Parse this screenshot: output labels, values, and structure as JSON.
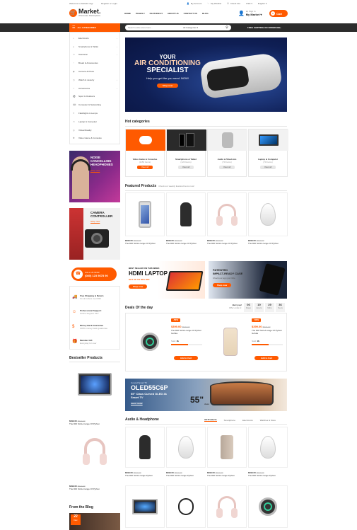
{
  "topbar": {
    "welcome": "Welcome to Default msg!",
    "register": "Register or Login",
    "account": "My Account",
    "wishlist": "My Wishlist",
    "checkout": "Check Out",
    "currency": "USD",
    "language": "English"
  },
  "brand": {
    "name": "Market.",
    "tagline": "Wholesale Marketplace"
  },
  "nav": [
    "HOME",
    "PAGES",
    "FEATURES",
    "ABOUT US",
    "CONTACT US",
    "BLOG"
  ],
  "user": {
    "signin": "Hi, Sign in",
    "account": "My Market"
  },
  "cart": {
    "count": "0",
    "label": "Cart"
  },
  "catbar": {
    "all": "ALL CATEGORIES",
    "search_placeholder": "Search entire store here...",
    "category_select": "All Categories",
    "free_shipping": "FREE SHIPPING ON ORDER $99+"
  },
  "sidebar_categories": [
    "Electronics",
    "Smartphone & Tablet",
    "Television",
    "Bread & Accessories",
    "Camera & Photo",
    "Watch & Jewelry",
    "Accessories",
    "Sport & Outdoors",
    "Computer & Networking",
    "Flashlights & Lamps",
    "Laptop & Computer",
    "Virtual Reality",
    "Video Game & Consoles"
  ],
  "hero": {
    "line1": "YOUR",
    "line2": "AIR CONDITIONING",
    "line3": "SPECIALIST",
    "sub": "Help you get the you need. NOW!",
    "btn": "Shop now"
  },
  "side_banner1": {
    "title": "NOISE CANCELLING HEADPHONES",
    "link": "Shop now"
  },
  "side_banner2": {
    "title": "CAMERA CONTROLLER",
    "link": "Shop now"
  },
  "hotline": {
    "label": "CALL US NOW",
    "number": "(080) 123 5678 90"
  },
  "services": [
    {
      "title": "Free Shipping & Return",
      "sub": "On all orders over $99"
    },
    {
      "title": "Professional Support",
      "sub": "Online Support 24/7"
    },
    {
      "title": "Money Back Guarantee",
      "sub": "100% money back guarantee"
    },
    {
      "title": "Member Gift",
      "sub": "Everyday for user"
    }
  ],
  "hot_categories": {
    "title": "Hot categories",
    "items": [
      {
        "name": "Video Game & Consoles",
        "count": "(1150 Items)",
        "btn": "View all"
      },
      {
        "name": "Smartphone & Tablet",
        "count": "(120 Items)",
        "btn": "View all"
      },
      {
        "name": "Audio & Television",
        "count": "(70 Items)",
        "btn": "View all"
      },
      {
        "name": "Laptop & Computer",
        "count": "(70 Items)",
        "btn": "View all"
      }
    ]
  },
  "featured": {
    "title": "Featured Products",
    "sub": "Check our weekly featured items now!",
    "items": [
      {
        "price": "$399.00",
        "old": "$520.00",
        "name": "The DDI SA/LA range Of Python"
      },
      {
        "price": "$399.00",
        "old": "$520.00",
        "name": "The DDI SA/LA range Of Python"
      },
      {
        "price": "$399.00",
        "old": "$520.00",
        "name": "The DDI SA/LA range Of Python"
      },
      {
        "price": "$399.00",
        "old": "$520.00",
        "name": "The DDI SA/LA range Of Python"
      }
    ]
  },
  "promo1": {
    "kicker": "BEST SELLER ON THIS WEEK",
    "title": "HDMI LAPTOP",
    "sub": "GET UP TO 50% OFF",
    "btn": "Shop now"
  },
  "promo2": {
    "kicker": "PATENTED",
    "title": "IMPACT-READY CASE",
    "sub": "Check our app port little",
    "btn": "Shop now"
  },
  "deals": {
    "title": "Deals Of the day",
    "hurry": "Hurry up!",
    "offer": "Offer ends in:",
    "timer": [
      {
        "v": "06",
        "l": "Days"
      },
      {
        "v": "19",
        "l": "Hours"
      },
      {
        "v": "29",
        "l": "Mins"
      },
      {
        "v": "36",
        "l": "Secs"
      }
    ],
    "items": [
      {
        "badge": "-50%",
        "price": "$399.00",
        "old": "$520.00",
        "name": "The DDI SA/LA range Of Python Gofuta",
        "sold_label": "Sold:",
        "sold": "2k",
        "btn": "Add to Cart",
        "progress": 0.55
      },
      {
        "badge": "-50%",
        "price": "$399.00",
        "old": "$520.00",
        "name": "The DDI SA/LA range Of Python Gofuta",
        "sold_label": "Sold:",
        "sold": "2k",
        "btn": "Add to Cart",
        "progress": 0.55
      }
    ]
  },
  "bestseller": {
    "title": "Bestseller Products",
    "items": [
      {
        "price": "$399.00",
        "old": "$520.00",
        "name": "The DDI SA/LA range Of Python"
      },
      {
        "price": "$399.00",
        "old": "$520.00",
        "name": "The DDI SA/LA range Of Python"
      }
    ]
  },
  "tv_banner": {
    "kicker": "Curved Smart TV",
    "model": "OLED55C6P",
    "line1": "55\" Class Curved OLED 4k",
    "line2": "Smart TV",
    "btn": "SHOP NOW",
    "size": "55\"",
    "size_label": "class"
  },
  "audio": {
    "title": "Audio & Headphone",
    "tabs": [
      "All Products",
      "Smartphone",
      "Electronics",
      "Watches & Store"
    ],
    "items": [
      {
        "price": "$399.00",
        "old": "$520.00",
        "name": "The DDI SA/LA range Python"
      },
      {
        "price": "$399.00",
        "old": "$520.00",
        "name": "The DDI SA/LA range Python"
      },
      {
        "price": "$399.00",
        "old": "$520.00",
        "name": "The DDI SA/LA range Python"
      },
      {
        "price": "$399.00",
        "old": "$520.00",
        "name": "The DDI SA/LA range Python"
      }
    ]
  },
  "blog": {
    "title": "From the Blog",
    "day": "22",
    "month": "Dec"
  }
}
